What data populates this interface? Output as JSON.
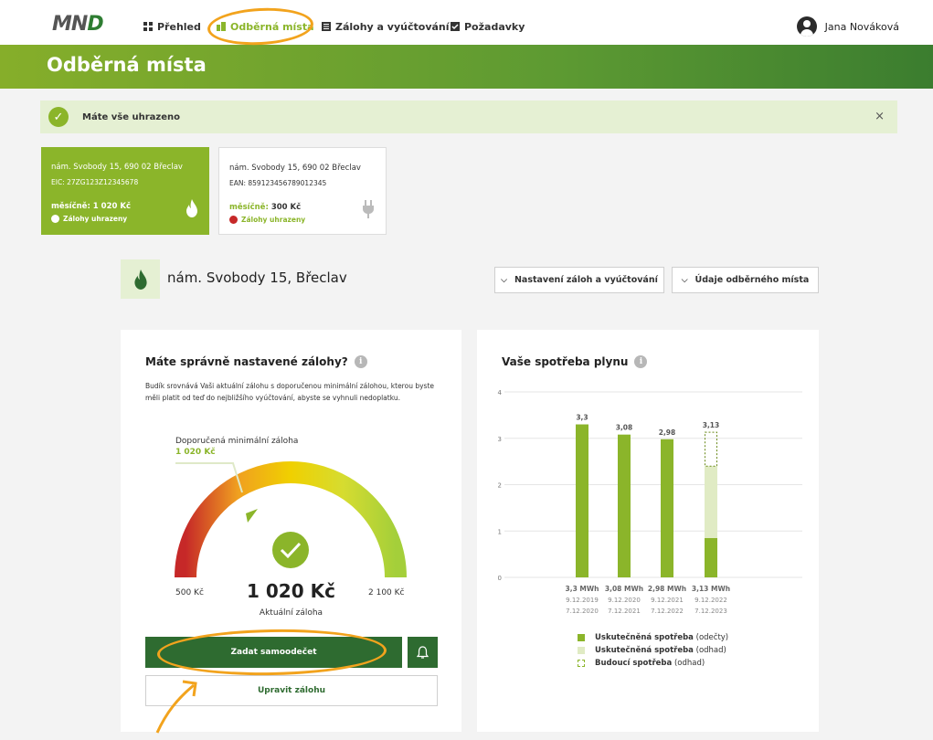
{
  "app": {
    "logo_main": "MN",
    "logo_accent": "D"
  },
  "nav": {
    "items": [
      {
        "label": "Přehled",
        "icon": "grid-icon"
      },
      {
        "label": "Odběrná místa",
        "icon": "building-icon"
      },
      {
        "label": "Zálohy a vyúčtování",
        "icon": "document-icon"
      },
      {
        "label": "Požadavky",
        "icon": "checkbox-icon"
      }
    ],
    "active": "Odběrná místa",
    "user_name": "Jana Nováková"
  },
  "page": {
    "title": "Odběrná místa"
  },
  "alert": {
    "text": "Máte vše uhrazeno",
    "close": "×"
  },
  "cards": [
    {
      "address": "nám. Svobody 15, 690 02 Břeclav",
      "code": "EIC: 27ZG123Z12345678",
      "monthly": "měsíčně: 1 020 Kč",
      "status": "Zálohy uhrazeny",
      "icon": "flame-icon"
    },
    {
      "address": "nám. Svobody 15, 690 02 Břeclav",
      "code": "EAN: 859123456789012345",
      "monthly_label": "měsíčně:",
      "monthly_value": "300 Kč",
      "status": "Zálohy uhrazeny",
      "icon": "plug-icon"
    }
  ],
  "place": {
    "name": "nám. Svobody 15, Břeclav",
    "btn_settings": "Nastavení záloh a vyúčtování",
    "btn_details": "Údaje odběrného místa"
  },
  "deposit": {
    "title": "Máte správně nastavené zálohy?",
    "description": "Budík srovnává Vaši aktuální zálohu s doporučenou minimální zálohou, kterou byste měli platit od teď do nejbližšího vyúčtování, abyste se vyhnuli nedoplatku.",
    "recommended_label": "Doporučená minimální záloha",
    "recommended_value": "1 020 Kč",
    "min_label": "500 Kč",
    "max_label": "2 100 Kč",
    "current_value": "1 020 Kč",
    "current_label": "Aktuální záloha",
    "btn_primary": "Zadat samoodečet",
    "btn_secondary": "Upravit zálohu"
  },
  "colors": {
    "brand_green": "#8bb52a",
    "dark_green": "#2e6b30",
    "light_green": "#e5f0d3",
    "annotation": "#f2a31d"
  },
  "chart_data": {
    "type": "bar",
    "title": "Vaše spotřeba plynu",
    "ylim": [
      0,
      4
    ],
    "yticks": [
      "0",
      "1",
      "2",
      "3",
      "4"
    ],
    "categories": [
      "3,3 MWh",
      "3,08 MWh",
      "2,98 MWh",
      "3,13 MWh"
    ],
    "date_from": [
      "9.12.2019",
      "9.12.2020",
      "9.12.2021",
      "9.12.2022"
    ],
    "date_to": [
      "7.12.2020",
      "7.12.2021",
      "7.12.2022",
      "7.12.2023"
    ],
    "value_labels": [
      "3,3",
      "3,08",
      "2,98",
      "3,13"
    ],
    "series": [
      {
        "name": "Uskutečněná spotřeba (odečty)",
        "values": [
          3.3,
          3.08,
          2.98,
          0.85
        ]
      },
      {
        "name": "Uskutečněná spotřeba (odhad)",
        "values": [
          0,
          0,
          0,
          1.55
        ]
      },
      {
        "name": "Budoucí spotřeba (odhad)",
        "values": [
          0,
          0,
          0,
          0.73
        ]
      }
    ],
    "legend": [
      {
        "bold": "Uskutečněná spotřeba",
        "rest": " (odečty)"
      },
      {
        "bold": "Uskutečněná spotřeba",
        "rest": " (odhad)"
      },
      {
        "bold": "Budoucí spotřeba",
        "rest": " (odhad)"
      }
    ],
    "legend_position": "bottom",
    "grid": true
  }
}
